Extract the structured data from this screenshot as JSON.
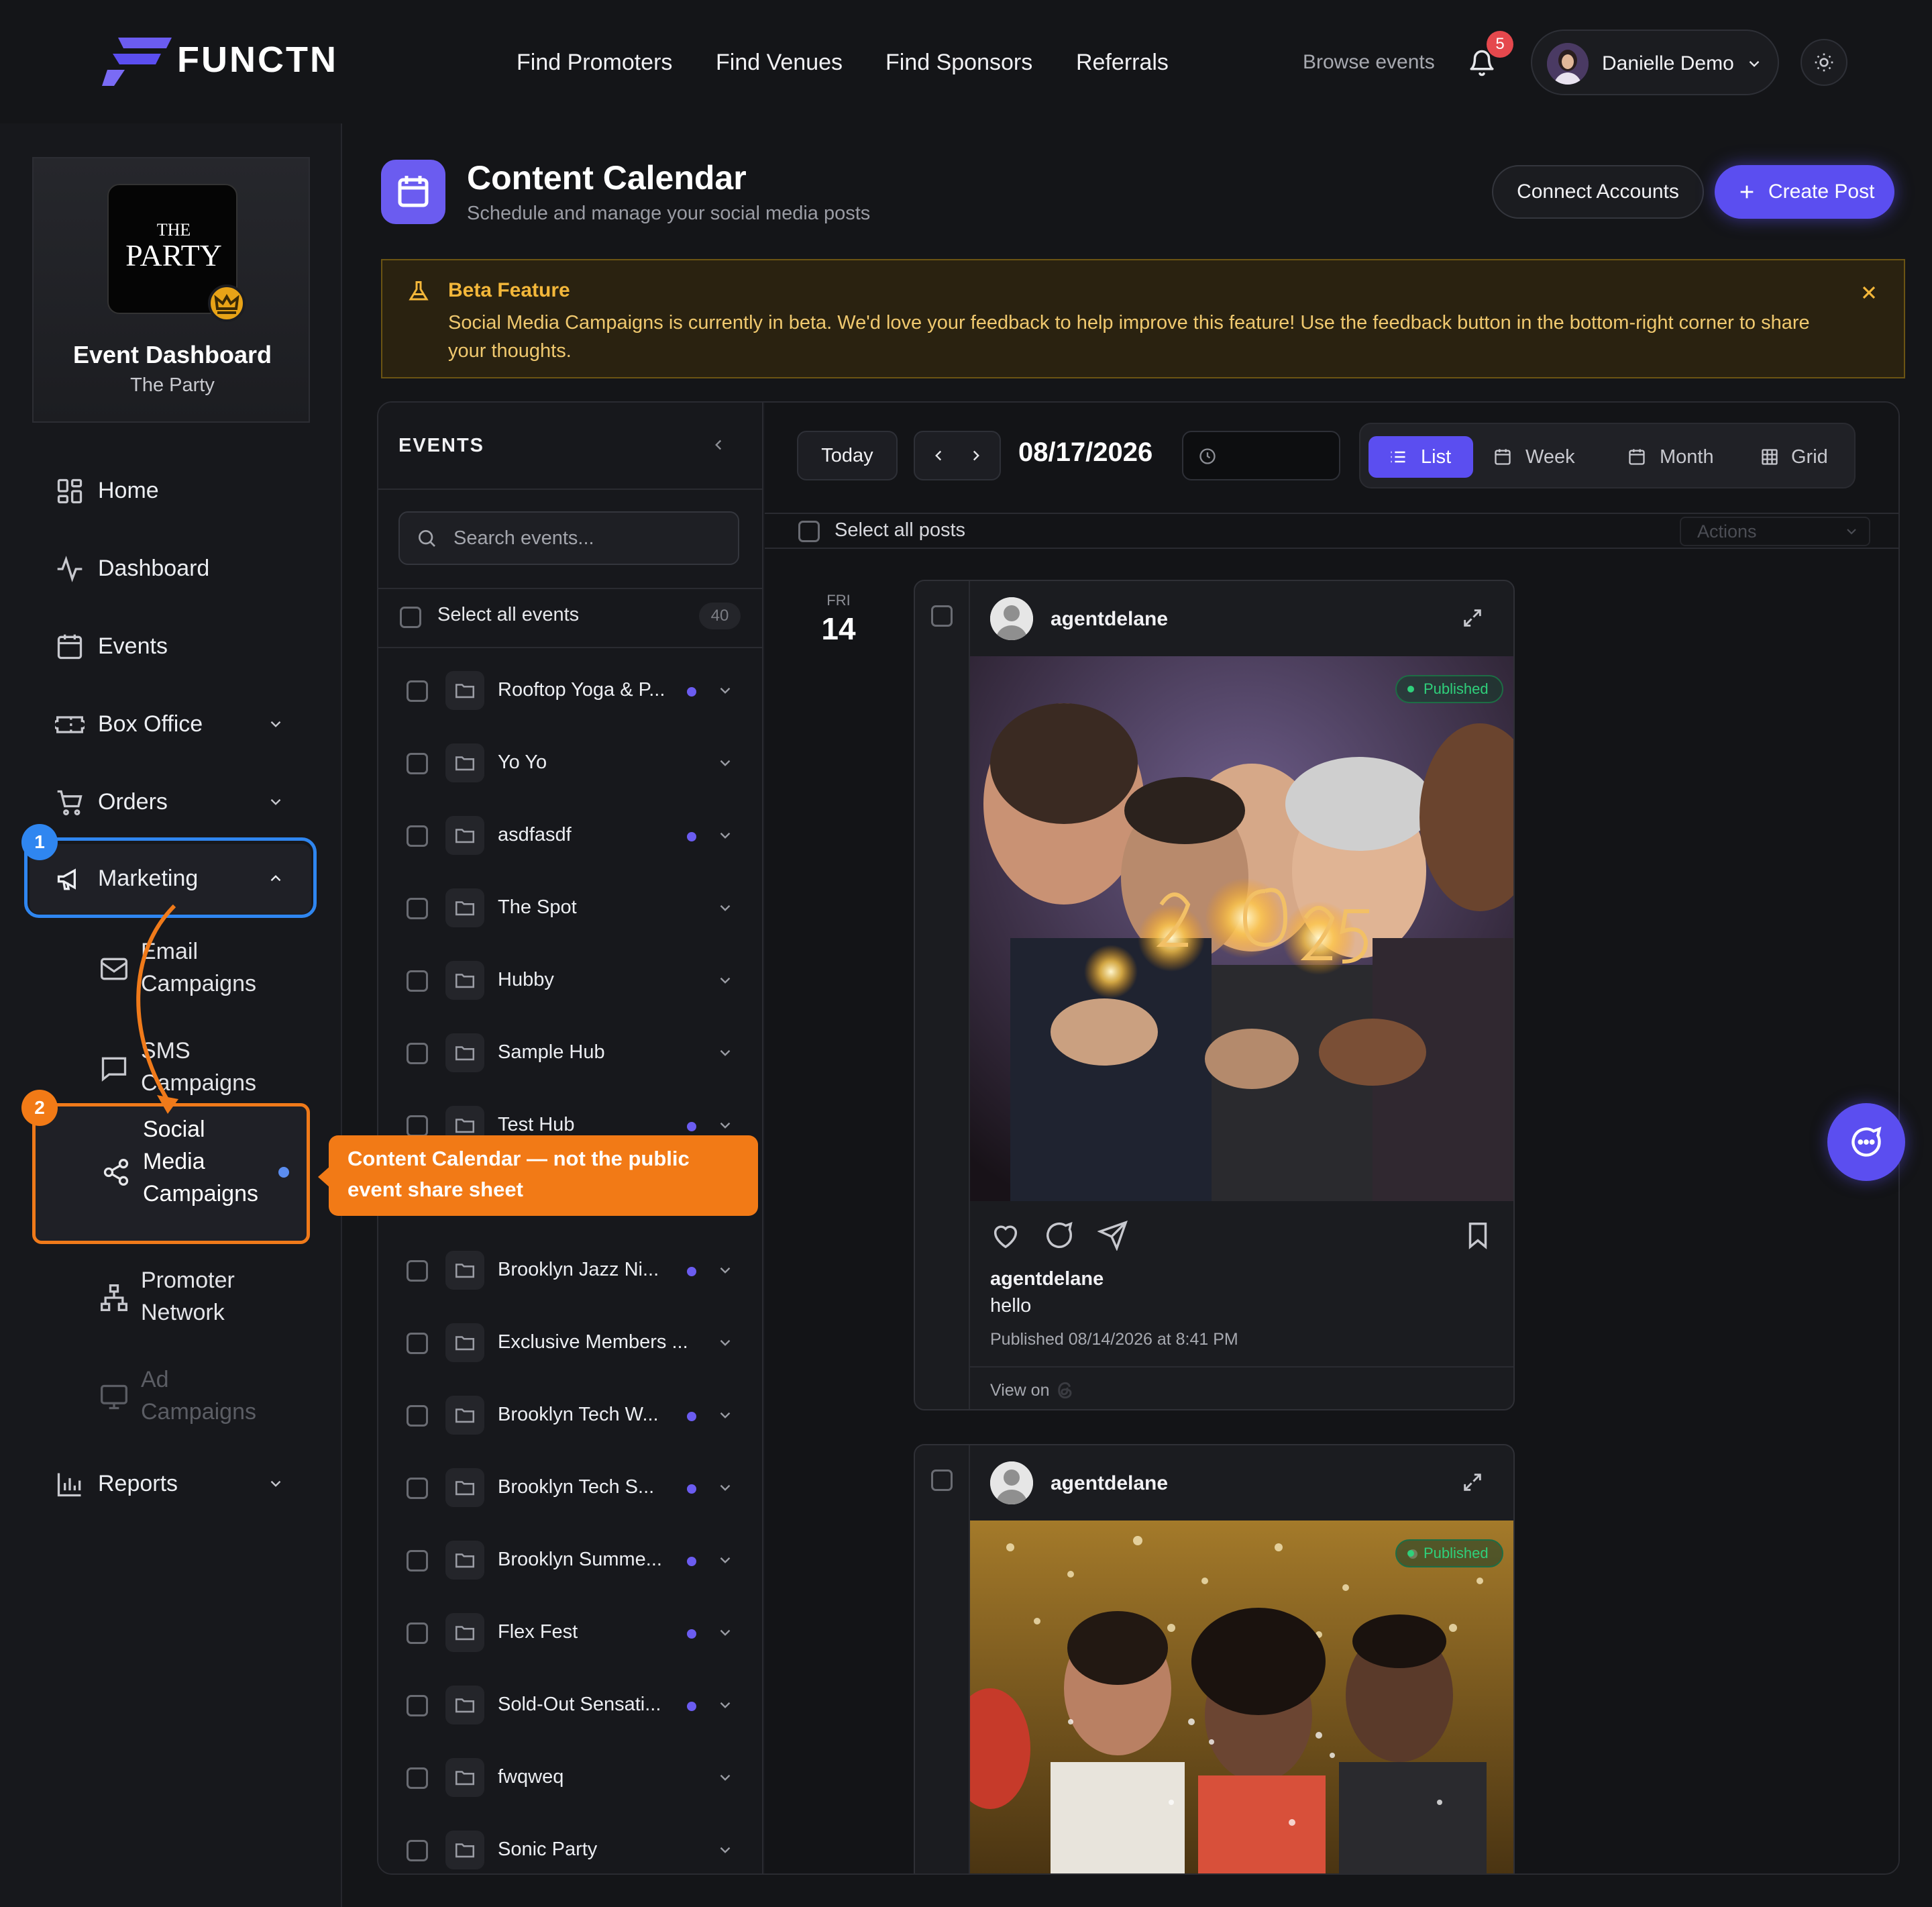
{
  "brand": {
    "name": "FUNCTN"
  },
  "topnav": {
    "links": [
      "Find Promoters",
      "Find Venues",
      "Find Sponsors",
      "Referrals"
    ],
    "browse": "Browse events",
    "notifications": "5",
    "user": "Danielle Demo"
  },
  "sidebar": {
    "event_logo_line1": "THE",
    "event_logo_line2": "PARTY",
    "event_title": "Event Dashboard",
    "event_name": "The Party",
    "items": {
      "home": "Home",
      "dashboard": "Dashboard",
      "events": "Events",
      "box_office": "Box Office",
      "orders": "Orders",
      "marketing": "Marketing",
      "email_1": "Email",
      "email_2": "Campaigns",
      "sms_1": "SMS",
      "sms_2": "Campaigns",
      "social_1": "Social",
      "social_2": "Media",
      "social_3": "Campaigns",
      "promoter_1": "Promoter",
      "promoter_2": "Network",
      "ad_1": "Ad",
      "ad_2": "Campaigns",
      "reports": "Reports"
    }
  },
  "header": {
    "title": "Content Calendar",
    "subtitle": "Schedule and manage your social media posts",
    "connect": "Connect Accounts",
    "create": "Create Post"
  },
  "beta": {
    "title": "Beta Feature",
    "text": "Social Media Campaigns is currently in beta. We'd love your feedback to help improve this feature! Use the feedback button in the bottom-right corner to share your thoughts."
  },
  "events_panel": {
    "heading": "EVENTS",
    "search_placeholder": "Search events...",
    "select_all": "Select all events",
    "count": "40",
    "events": [
      {
        "name": "Rooftop Yoga & P...",
        "dot": true
      },
      {
        "name": "Yo Yo",
        "dot": false
      },
      {
        "name": "asdfasdf",
        "dot": true
      },
      {
        "name": "The Spot",
        "dot": false
      },
      {
        "name": "Hubby",
        "dot": false
      },
      {
        "name": "Sample Hub",
        "dot": false
      },
      {
        "name": "Test Hub",
        "dot": true
      },
      {
        "name": "",
        "dot": false
      },
      {
        "name": "Brooklyn Jazz Ni...",
        "dot": true
      },
      {
        "name": "Exclusive Members ...",
        "dot": false
      },
      {
        "name": "Brooklyn Tech W...",
        "dot": true
      },
      {
        "name": "Brooklyn Tech S...",
        "dot": true
      },
      {
        "name": "Brooklyn Summe...",
        "dot": true
      },
      {
        "name": "Flex Fest",
        "dot": true
      },
      {
        "name": "Sold-Out Sensati...",
        "dot": true
      },
      {
        "name": "fwqweq",
        "dot": false
      },
      {
        "name": "Sonic Party",
        "dot": false
      }
    ]
  },
  "calendar": {
    "today": "Today",
    "date": "08/17/2026",
    "views": [
      "List",
      "Week",
      "Month",
      "Grid"
    ],
    "active_view": "List",
    "select_all_posts": "Select all posts",
    "actions": "Actions",
    "day_of_week": "FRI",
    "day_num": "14"
  },
  "posts": [
    {
      "user": "agentdelane",
      "status": "Published",
      "caption_user": "agentdelane",
      "caption": "hello",
      "date": "Published 08/14/2026 at 8:41 PM",
      "view_on": "View on",
      "image": "friends-with-sparklers-2025"
    },
    {
      "user": "agentdelane",
      "status": "Published",
      "image": "friends-blowing-confetti"
    }
  ],
  "annotations": {
    "step1": "1",
    "step2": "2",
    "callout": "Content Calendar — not the public event share sheet"
  },
  "colors": {
    "accent": "#5b4ef0",
    "warning": "#f3b73a",
    "annotation_blue": "#2f86f0",
    "annotation_orange": "#f27a16",
    "published": "#2fd07b"
  }
}
